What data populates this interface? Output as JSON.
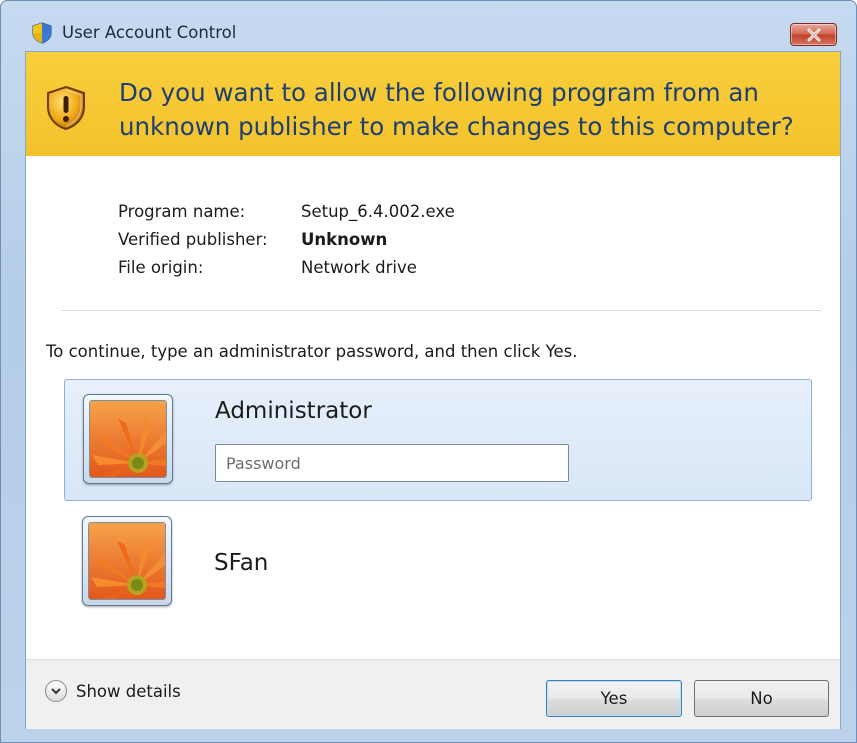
{
  "window": {
    "title": "User Account Control"
  },
  "banner": {
    "question": "Do you want to allow the following program from an unknown publisher to make changes to this computer?"
  },
  "program_info": [
    {
      "label": "Program name:",
      "value": "Setup_6.4.002.exe",
      "bold": false
    },
    {
      "label": "Verified publisher:",
      "value": "Unknown",
      "bold": true
    },
    {
      "label": "File origin:",
      "value": "Network drive",
      "bold": false
    }
  ],
  "instruction": "To continue, type an administrator password, and then click Yes.",
  "users": [
    {
      "name": "Administrator",
      "selected": true
    },
    {
      "name": "SFan",
      "selected": false
    }
  ],
  "password": {
    "placeholder": "Password",
    "value": ""
  },
  "footer": {
    "show_details_label": "Show details",
    "yes_label": "Yes",
    "no_label": "No"
  },
  "colors": {
    "banner": "#f5c732",
    "banner_text": "#1e3f72",
    "window_frame": "#bcd2ea",
    "close_button": "#c9503a",
    "selected_tile": "#dce9f7"
  },
  "icons": {
    "title": "uac-shield-icon",
    "banner": "warning-shield-icon",
    "close": "close-icon",
    "details": "chevron-down-icon",
    "avatar": "flower-avatar-icon"
  }
}
